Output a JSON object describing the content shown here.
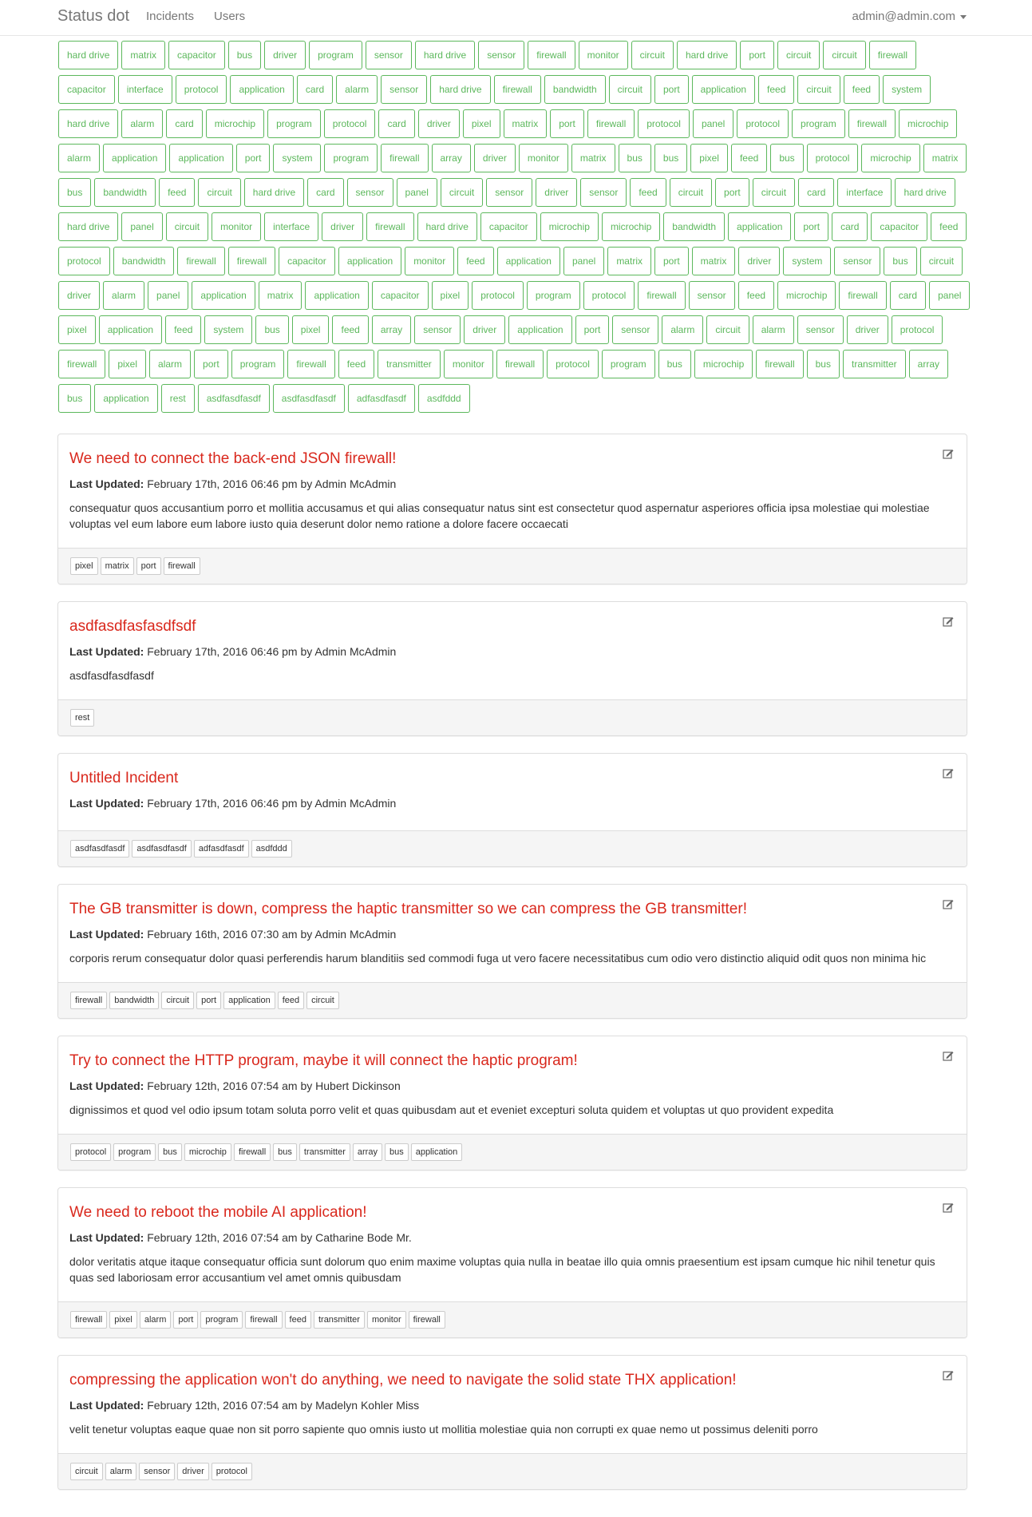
{
  "nav": {
    "brand": "Status dot",
    "links": [
      "Incidents",
      "Users"
    ],
    "user": "admin@admin.com"
  },
  "filter_tags": [
    "hard drive",
    "matrix",
    "capacitor",
    "bus",
    "driver",
    "program",
    "sensor",
    "hard drive",
    "sensor",
    "firewall",
    "monitor",
    "circuit",
    "hard drive",
    "port",
    "circuit",
    "circuit",
    "firewall",
    "capacitor",
    "interface",
    "protocol",
    "application",
    "card",
    "alarm",
    "sensor",
    "hard drive",
    "firewall",
    "bandwidth",
    "circuit",
    "port",
    "application",
    "feed",
    "circuit",
    "feed",
    "system",
    "hard drive",
    "alarm",
    "card",
    "microchip",
    "program",
    "protocol",
    "card",
    "driver",
    "pixel",
    "matrix",
    "port",
    "firewall",
    "protocol",
    "panel",
    "protocol",
    "program",
    "firewall",
    "microchip",
    "alarm",
    "application",
    "application",
    "port",
    "system",
    "program",
    "firewall",
    "array",
    "driver",
    "monitor",
    "matrix",
    "bus",
    "bus",
    "pixel",
    "feed",
    "bus",
    "protocol",
    "microchip",
    "matrix",
    "bus",
    "bandwidth",
    "feed",
    "circuit",
    "hard drive",
    "card",
    "sensor",
    "panel",
    "circuit",
    "sensor",
    "driver",
    "sensor",
    "feed",
    "circuit",
    "port",
    "circuit",
    "card",
    "interface",
    "hard drive",
    "hard drive",
    "panel",
    "circuit",
    "monitor",
    "interface",
    "driver",
    "firewall",
    "hard drive",
    "capacitor",
    "microchip",
    "microchip",
    "bandwidth",
    "application",
    "port",
    "card",
    "capacitor",
    "feed",
    "protocol",
    "bandwidth",
    "firewall",
    "firewall",
    "capacitor",
    "application",
    "monitor",
    "feed",
    "application",
    "panel",
    "matrix",
    "port",
    "matrix",
    "driver",
    "system",
    "sensor",
    "bus",
    "circuit",
    "driver",
    "alarm",
    "panel",
    "application",
    "matrix",
    "application",
    "capacitor",
    "pixel",
    "protocol",
    "program",
    "protocol",
    "firewall",
    "sensor",
    "feed",
    "microchip",
    "firewall",
    "card",
    "panel",
    "pixel",
    "application",
    "feed",
    "system",
    "bus",
    "pixel",
    "feed",
    "array",
    "sensor",
    "driver",
    "application",
    "port",
    "sensor",
    "alarm",
    "circuit",
    "alarm",
    "sensor",
    "driver",
    "protocol",
    "firewall",
    "pixel",
    "alarm",
    "port",
    "program",
    "firewall",
    "feed",
    "transmitter",
    "monitor",
    "firewall",
    "protocol",
    "program",
    "bus",
    "microchip",
    "firewall",
    "bus",
    "transmitter",
    "array",
    "bus",
    "application",
    "rest",
    "asdfasdfasdf",
    "asdfasdfasdf",
    "adfasdfasdf",
    "asdfddd"
  ],
  "incidents": [
    {
      "title": "We need to connect the back-end JSON firewall!",
      "updated_label": "Last Updated:",
      "meta": " February 17th, 2016 06:46 pm by Admin McAdmin",
      "description": "consequatur quos accusantium porro et mollitia accusamus et qui alias consequatur natus sint est consectetur quod aspernatur asperiores officia ipsa molestiae qui molestiae voluptas vel eum labore eum labore iusto quia deserunt dolor nemo ratione a dolore facere occaecati",
      "tags": [
        "pixel",
        "matrix",
        "port",
        "firewall"
      ]
    },
    {
      "title": "asdfasdfasfasdfsdf",
      "updated_label": "Last Updated:",
      "meta": " February 17th, 2016 06:46 pm by Admin McAdmin",
      "description": "asdfasdfasdfasdf",
      "tags": [
        "rest"
      ]
    },
    {
      "title": "Untitled Incident",
      "updated_label": "Last Updated:",
      "meta": " February 17th, 2016 06:46 pm by Admin McAdmin",
      "description": "",
      "tags": [
        "asdfasdfasdf",
        "asdfasdfasdf",
        "adfasdfasdf",
        "asdfddd"
      ]
    },
    {
      "title": "The GB transmitter is down, compress the haptic transmitter so we can compress the GB transmitter!",
      "updated_label": "Last Updated:",
      "meta": " February 16th, 2016 07:30 am by Admin McAdmin",
      "description": "corporis rerum consequatur dolor quasi perferendis harum blanditiis sed commodi fuga ut vero facere necessitatibus cum odio vero distinctio aliquid odit quos non minima hic",
      "tags": [
        "firewall",
        "bandwidth",
        "circuit",
        "port",
        "application",
        "feed",
        "circuit"
      ]
    },
    {
      "title": "Try to connect the HTTP program, maybe it will connect the haptic program!",
      "updated_label": "Last Updated:",
      "meta": " February 12th, 2016 07:54 am by Hubert Dickinson",
      "description": "dignissimos et quod vel odio ipsum totam soluta porro velit et quas quibusdam aut et eveniet excepturi soluta quidem et voluptas ut quo provident expedita",
      "tags": [
        "protocol",
        "program",
        "bus",
        "microchip",
        "firewall",
        "bus",
        "transmitter",
        "array",
        "bus",
        "application"
      ]
    },
    {
      "title": "We need to reboot the mobile AI application!",
      "updated_label": "Last Updated:",
      "meta": " February 12th, 2016 07:54 am by Catharine Bode Mr.",
      "description": "dolor veritatis atque itaque consequatur officia sunt dolorum quo enim maxime voluptas quia nulla in beatae illo quia omnis praesentium est ipsam cumque hic nihil tenetur quis quas sed laboriosam error accusantium vel amet omnis quibusdam",
      "tags": [
        "firewall",
        "pixel",
        "alarm",
        "port",
        "program",
        "firewall",
        "feed",
        "transmitter",
        "monitor",
        "firewall"
      ]
    },
    {
      "title": "compressing the application won't do anything, we need to navigate the solid state THX application!",
      "updated_label": "Last Updated:",
      "meta": " February 12th, 2016 07:54 am by Madelyn Kohler Miss",
      "description": "velit tenetur voluptas eaque quae non sit porro sapiente quo omnis iusto ut mollitia molestiae quia non corrupti ex quae nemo ut possimus deleniti porro",
      "tags": [
        "circuit",
        "alarm",
        "sensor",
        "driver",
        "protocol"
      ]
    }
  ],
  "icons": {
    "edit": "edit-icon",
    "caret": "chevron-down-icon"
  },
  "colors": {
    "tag_green": "#5cb85c",
    "title_red": "#d9281d"
  }
}
